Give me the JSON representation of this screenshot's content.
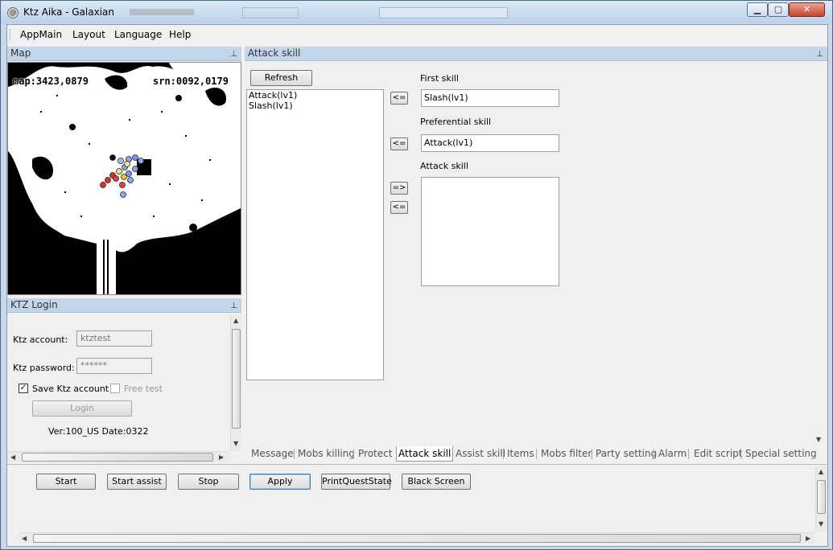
{
  "window": {
    "title": "Ktz Aika - Galaxian",
    "icon": "app-icon"
  },
  "menu": [
    "AppMain",
    "Layout",
    "Language",
    "Help"
  ],
  "map": {
    "title": "Map",
    "map_coord": "map:3423,0879",
    "screen_coord": "srn:0092,0179"
  },
  "login": {
    "title": "KTZ Login",
    "account_label": "Ktz account:",
    "account_value": "ktztest",
    "password_label": "Ktz password:",
    "password_value": "******",
    "save_label": "Save Ktz account",
    "save_checked": true,
    "free_label": "Free test",
    "login_button": "Login",
    "version": "Ver:100_US Date:0322"
  },
  "skill": {
    "title": "Attack skill",
    "refresh_button": "Refresh",
    "skills": [
      "Attack(lv1)",
      "Slash(lv1)"
    ],
    "first_label": "First skill",
    "first_value": "Slash(lv1)",
    "pref_label": "Preferential skill",
    "pref_value": "Attack(lv1)",
    "attack_label": "Attack skill",
    "move_left": "<=",
    "move_right": "=>"
  },
  "tabs": [
    "Message",
    "Mobs killing",
    "Protect",
    "Attack skill",
    "Assist skill",
    "Items",
    "Mobs filter",
    "Party setting",
    "Alarm",
    "Edit script",
    "Special setting"
  ],
  "active_tab": "Attack skill",
  "bottom_buttons": [
    "Start",
    "Start assist",
    "Stop",
    "Apply",
    "PrintQuestState",
    "Black Screen"
  ]
}
